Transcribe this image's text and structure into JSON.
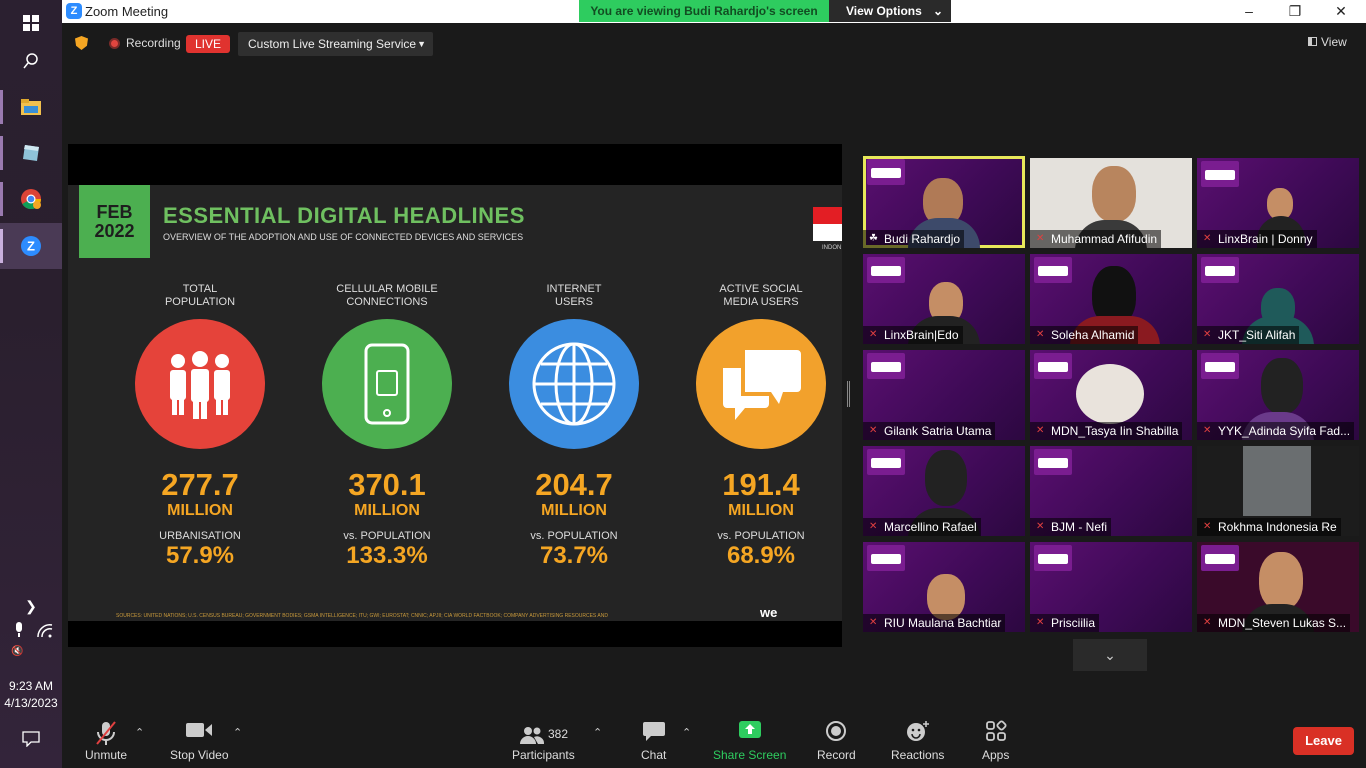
{
  "taskbar": {
    "time": "9:23 AM",
    "date": "4/13/2023"
  },
  "window": {
    "title": "Zoom Meeting",
    "min": "–",
    "max": "❐",
    "close": "✕"
  },
  "banner": {
    "viewing": "You are viewing Budi Rahardjo's screen",
    "view_options": "View Options"
  },
  "toolbar_top": {
    "recording": "Recording",
    "live": "LIVE",
    "stream": "Custom Live Streaming Service",
    "view": "View"
  },
  "slide": {
    "month": "FEB",
    "year": "2022",
    "title": "ESSENTIAL DIGITAL HEADLINES",
    "subtitle": "OVERVIEW OF THE ADOPTION AND USE OF CONNECTED DEVICES AND SERVICES",
    "country": "INDON",
    "stats": [
      {
        "label1": "TOTAL",
        "label2": "POPULATION",
        "value": "277.7",
        "unit": "MILLION",
        "sub": "URBANISATION",
        "pct": "57.9%",
        "icon": "people-icon",
        "color": "#e5433a"
      },
      {
        "label1": "CELLULAR MOBILE",
        "label2": "CONNECTIONS",
        "value": "370.1",
        "unit": "MILLION",
        "sub": "vs. POPULATION",
        "pct": "133.3%",
        "icon": "phone-icon",
        "color": "#4caf50"
      },
      {
        "label1": "INTERNET",
        "label2": "USERS",
        "value": "204.7",
        "unit": "MILLION",
        "sub": "vs. POPULATION",
        "pct": "73.7%",
        "icon": "globe-icon",
        "color": "#3b8de0"
      },
      {
        "label1": "ACTIVE SOCIAL",
        "label2": "MEDIA USERS",
        "value": "191.4",
        "unit": "MILLION",
        "sub": "vs. POPULATION",
        "pct": "68.9%",
        "icon": "chat-icon",
        "color": "#f2a12c"
      }
    ],
    "sources": "SOURCES: UNITED NATIONS; U.S. CENSUS BUREAU; GOVERNMENT BODIES; GSMA INTELLIGENCE; ITU; GWI; EUROSTAT; CNNIC; APJII; CIA WORLD FACTBOOK; COMPANY ADVERTISING RESOURCES AND",
    "brand": "we"
  },
  "participants": [
    {
      "name": "Budi Rahardjo"
    },
    {
      "name": "Muhammad Afifudin"
    },
    {
      "name": "LinxBrain | Donny"
    },
    {
      "name": "LinxBrain|Edo"
    },
    {
      "name": "Soleha Alhamid"
    },
    {
      "name": "JKT_Siti Alifah"
    },
    {
      "name": "Gilank Satria Utama"
    },
    {
      "name": "MDN_Tasya Iin Shabilla"
    },
    {
      "name": "YYK_Adinda Syifa Fad..."
    },
    {
      "name": "Marcellino Rafael"
    },
    {
      "name": "BJM - Nefi"
    },
    {
      "name": "Rokhma Indonesia Re"
    },
    {
      "name": "RIU Maulana Bachtiar"
    },
    {
      "name": "Prisciilia"
    },
    {
      "name": "MDN_Steven Lukas S..."
    }
  ],
  "bottom": {
    "unmute": "Unmute",
    "stop_video": "Stop Video",
    "participants": "Participants",
    "participants_count": "382",
    "chat": "Chat",
    "share": "Share Screen",
    "record": "Record",
    "reactions": "Reactions",
    "apps": "Apps",
    "leave": "Leave"
  }
}
